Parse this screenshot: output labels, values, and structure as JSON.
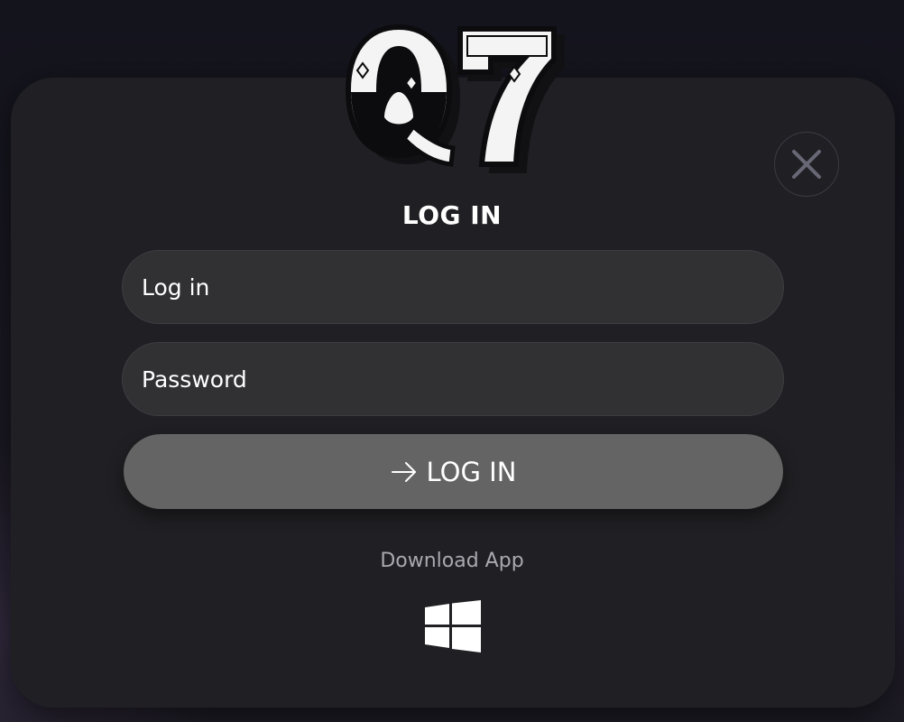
{
  "brand": {
    "logo_text": "Q7",
    "logo_icon": "q7-logo"
  },
  "modal": {
    "title": "LOG IN",
    "close_icon": "close-icon"
  },
  "form": {
    "login": {
      "value": "",
      "placeholder": "Log in"
    },
    "password": {
      "value": "",
      "placeholder": "Password"
    },
    "submit": {
      "label": "LOG IN",
      "icon": "arrow-right-icon"
    }
  },
  "download": {
    "label": "Download App",
    "platforms": [
      {
        "icon": "windows-icon"
      }
    ]
  },
  "colors": {
    "modal_bg": "#202024",
    "field_bg": "#313134",
    "button_bg": "#646464",
    "text": "#ffffff",
    "muted_text": "#a8a8ae"
  }
}
